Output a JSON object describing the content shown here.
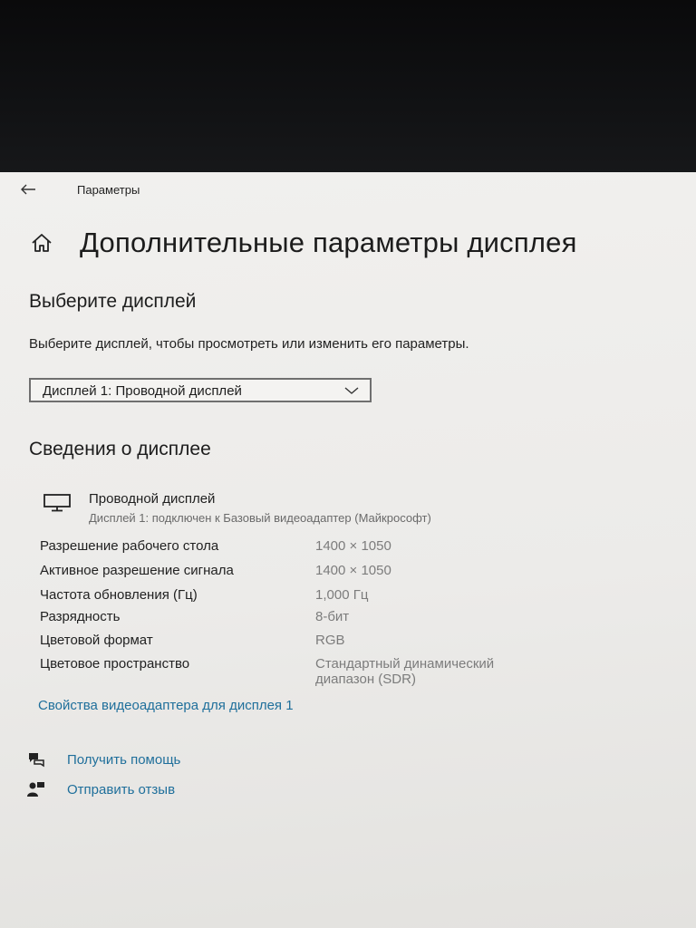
{
  "window": {
    "title": "Параметры"
  },
  "page": {
    "title": "Дополнительные параметры дисплея"
  },
  "select_display": {
    "heading": "Выберите дисплей",
    "description": "Выберите дисплей, чтобы просмотреть или изменить его параметры.",
    "dropdown_value": "Дисплей 1: Проводной дисплей"
  },
  "display_info": {
    "heading": "Сведения о дисплее",
    "display_name": "Проводной дисплей",
    "display_subtitle": "Дисплей 1: подключен к Базовый видеоадаптер (Майкрософт)",
    "rows": [
      {
        "label": "Разрешение рабочего стола",
        "value": "1400 × 1050"
      },
      {
        "label": "Активное разрешение сигнала",
        "value": "1400 × 1050"
      },
      {
        "label": "Частота обновления (Гц)",
        "value": "1,000 Гц"
      },
      {
        "label": "Разрядность",
        "value": "8-бит"
      },
      {
        "label": "Цветовой формат",
        "value": "RGB"
      },
      {
        "label": "Цветовое пространство",
        "value": "Стандартный динамический диапазон (SDR)"
      }
    ],
    "adapter_link": "Свойства видеоадаптера для дисплея 1"
  },
  "help": {
    "get_help": "Получить помощь",
    "feedback": "Отправить отзыв"
  },
  "colors": {
    "link": "#1f6f9b",
    "background": "#eeedeb",
    "secondary_text": "#7c7c7c"
  },
  "icons": [
    "back-arrow-icon",
    "home-icon",
    "chevron-down-icon",
    "monitor-icon",
    "help-chat-icon",
    "feedback-person-icon"
  ]
}
